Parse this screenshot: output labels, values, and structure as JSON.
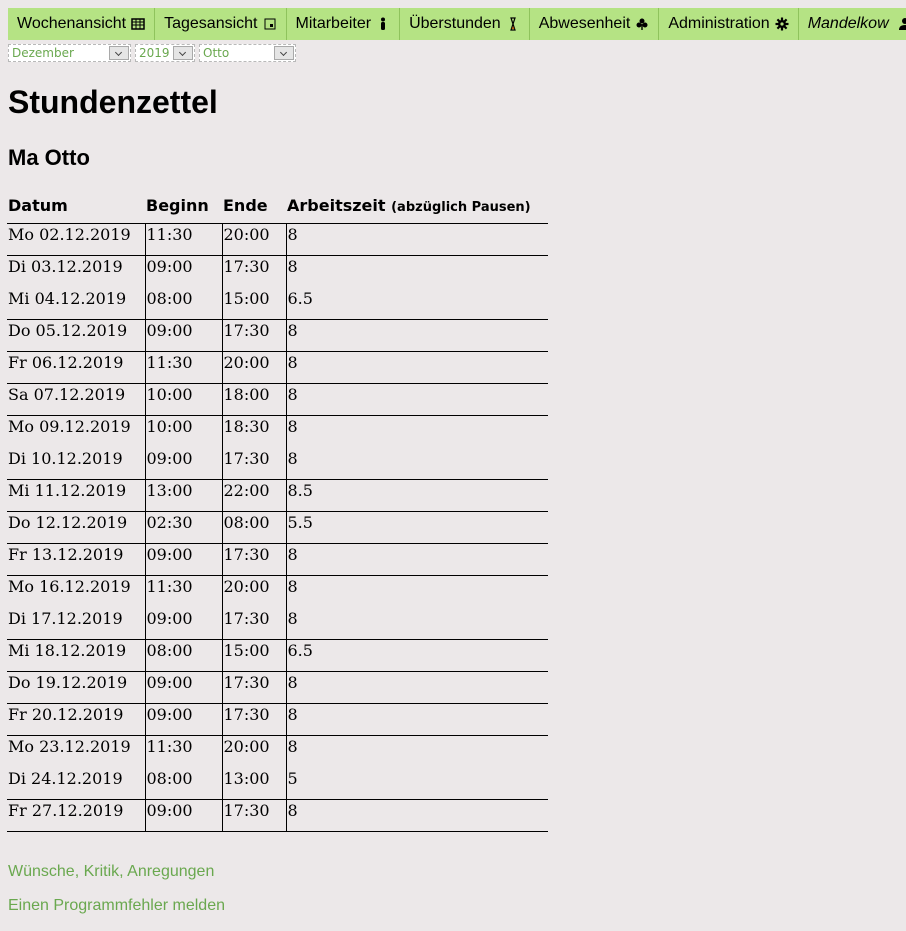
{
  "nav": {
    "items": [
      {
        "label": "Wochenansicht",
        "icon": "calendar-grid-icon"
      },
      {
        "label": "Tagesansicht",
        "icon": "calendar-day-icon"
      },
      {
        "label": "Mitarbeiter",
        "icon": "person-icon"
      },
      {
        "label": "Überstunden",
        "icon": "hourglass-icon"
      },
      {
        "label": "Abwesenheit",
        "icon": "beach-icon"
      },
      {
        "label": "Administration",
        "icon": "gear-icon"
      },
      {
        "label": "Mandelkow",
        "icon": "user-icon"
      }
    ]
  },
  "filters": {
    "month": "Dezember",
    "year": "2019",
    "employee": "Otto"
  },
  "page_title": "Stundenzettel",
  "employee_name": "Ma Otto",
  "table": {
    "headers": {
      "date": "Datum",
      "start": "Beginn",
      "end": "Ende",
      "worktime": "Arbeitszeit",
      "worktime_note": "(abzüglich Pausen)"
    },
    "rows": [
      [
        "Mo 02.12.2019",
        "11:30",
        "20:00",
        "8"
      ],
      [
        "Di 03.12.2019",
        "09:00",
        "17:30",
        "8"
      ],
      [
        "Mi 04.12.2019",
        "08:00",
        "15:00",
        "6.5"
      ],
      [
        "Do 05.12.2019",
        "09:00",
        "17:30",
        "8"
      ],
      [
        "Fr 06.12.2019",
        "11:30",
        "20:00",
        "8"
      ],
      [
        "Sa 07.12.2019",
        "10:00",
        "18:00",
        "8"
      ],
      [
        "Mo 09.12.2019",
        "10:00",
        "18:30",
        "8"
      ],
      [
        "Di 10.12.2019",
        "09:00",
        "17:30",
        "8"
      ],
      [
        "Mi 11.12.2019",
        "13:00",
        "22:00",
        "8.5"
      ],
      [
        "Do 12.12.2019",
        "02:30",
        "08:00",
        "5.5"
      ],
      [
        "Fr 13.12.2019",
        "09:00",
        "17:30",
        "8"
      ],
      [
        "Mo 16.12.2019",
        "11:30",
        "20:00",
        "8"
      ],
      [
        "Di 17.12.2019",
        "09:00",
        "17:30",
        "8"
      ],
      [
        "Mi 18.12.2019",
        "08:00",
        "15:00",
        "6.5"
      ],
      [
        "Do 19.12.2019",
        "09:00",
        "17:30",
        "8"
      ],
      [
        "Fr 20.12.2019",
        "09:00",
        "17:30",
        "8"
      ],
      [
        "Mo 23.12.2019",
        "11:30",
        "20:00",
        "8"
      ],
      [
        "Di 24.12.2019",
        "08:00",
        "13:00",
        "5"
      ],
      [
        "Fr 27.12.2019",
        "09:00",
        "17:30",
        "8"
      ]
    ],
    "group_starts": [
      true,
      true,
      false,
      true,
      true,
      true,
      true,
      false,
      true,
      true,
      true,
      true,
      false,
      true,
      true,
      true,
      true,
      false,
      true
    ]
  },
  "footer": {
    "feedback_link": "Wünsche, Kritik, Anregungen",
    "bug_link": "Einen Programmfehler melden"
  }
}
